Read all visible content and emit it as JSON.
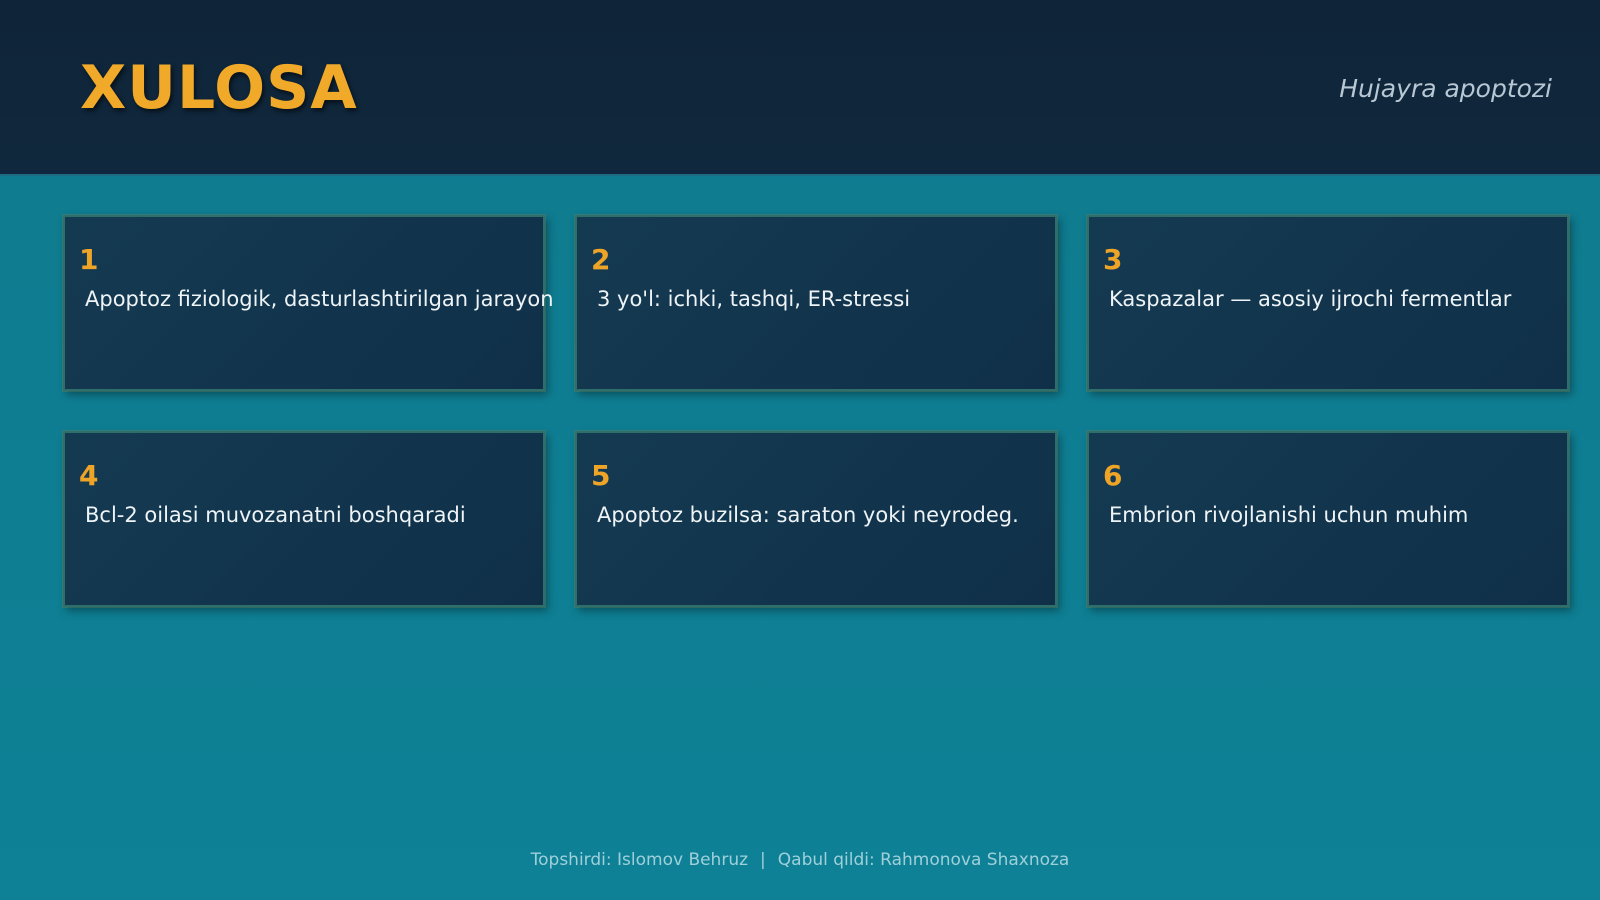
{
  "header": {
    "title": "XULOSA",
    "subtitle": "Hujayra apoptozi"
  },
  "cards": [
    {
      "number": "1",
      "text": "Apoptoz fiziologik, dasturlashtirilgan jarayon"
    },
    {
      "number": "2",
      "text": "3 yo'l: ichki, tashqi, ER-stressi"
    },
    {
      "number": "3",
      "text": "Kaspazalar — asosiy ijrochi fermentlar"
    },
    {
      "number": "4",
      "text": "Bcl-2 oilasi muvozanatni boshqaradi"
    },
    {
      "number": "5",
      "text": "Apoptoz buzilsa: saraton yoki neyrodeg."
    },
    {
      "number": "6",
      "text": "Embrion rivojlanishi uchun muhim"
    }
  ],
  "footer": {
    "submitted": "Topshirdi: Islomov Behruz",
    "separator": "|",
    "accepted": "Qabul qildi: Rahmonova Shaxnoza"
  },
  "colors": {
    "header_bg": "#0f2438",
    "slide_bg": "#0e7d90",
    "accent": "#f0a928",
    "card_bg": "#143a52",
    "card_text": "#eef3f6",
    "footer_text": "#9fd0da"
  }
}
